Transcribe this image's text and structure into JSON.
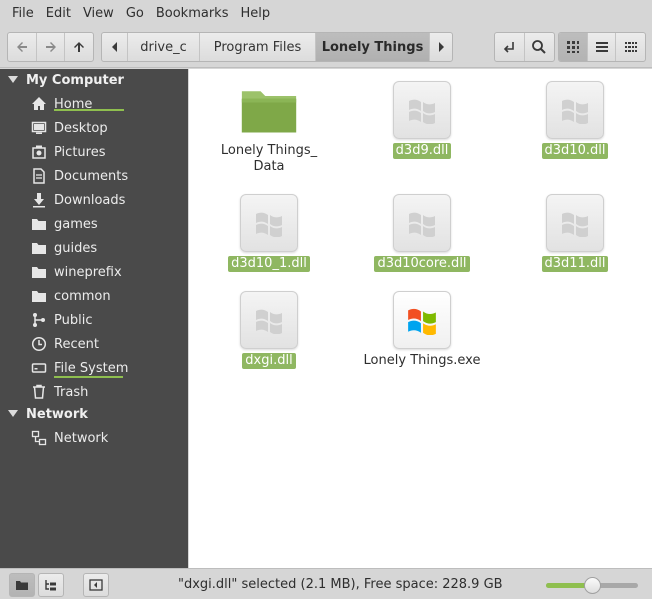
{
  "menu": [
    "File",
    "Edit",
    "View",
    "Go",
    "Bookmarks",
    "Help"
  ],
  "breadcrumbs": [
    "drive_c",
    "Program Files",
    "Lonely Things"
  ],
  "sidebar": {
    "sections": [
      {
        "title": "My Computer"
      },
      {
        "title": "Network"
      }
    ],
    "items": [
      {
        "label": "Home",
        "icon": "home-icon"
      },
      {
        "label": "Desktop",
        "icon": "desktop-icon"
      },
      {
        "label": "Pictures",
        "icon": "pictures-icon"
      },
      {
        "label": "Documents",
        "icon": "documents-icon"
      },
      {
        "label": "Downloads",
        "icon": "downloads-icon"
      },
      {
        "label": "games",
        "icon": "folder-icon"
      },
      {
        "label": "guides",
        "icon": "folder-icon"
      },
      {
        "label": "wineprefix",
        "icon": "folder-icon"
      },
      {
        "label": "common",
        "icon": "folder-icon"
      },
      {
        "label": "Public",
        "icon": "share-icon"
      },
      {
        "label": "Recent",
        "icon": "clock-icon"
      },
      {
        "label": "File System",
        "icon": "drive-icon"
      },
      {
        "label": "Trash",
        "icon": "trash-icon"
      },
      {
        "label": "Network",
        "icon": "network-icon"
      }
    ]
  },
  "files": [
    {
      "name": "Lonely Things_",
      "name2": "Data",
      "type": "folder",
      "selected": false
    },
    {
      "name": "d3d9.dll",
      "type": "dll",
      "selected": true
    },
    {
      "name": "d3d10.dll",
      "type": "dll",
      "selected": true
    },
    {
      "name": "d3d10_1.dll",
      "type": "dll",
      "selected": true
    },
    {
      "name": "d3d10core.dll",
      "type": "dll",
      "selected": true
    },
    {
      "name": "d3d11.dll",
      "type": "dll",
      "selected": true
    },
    {
      "name": "dxgi.dll",
      "type": "dll",
      "selected": true
    },
    {
      "name": "Lonely Things.exe",
      "type": "exe",
      "selected": false
    }
  ],
  "status": {
    "text": "\"dxgi.dll\" selected (2.1 MB), Free space: 228.9 GB",
    "zoom_fraction": 0.5
  },
  "colors": {
    "accent": "#8fb761",
    "sidebar_bg": "#4a4a4a"
  }
}
